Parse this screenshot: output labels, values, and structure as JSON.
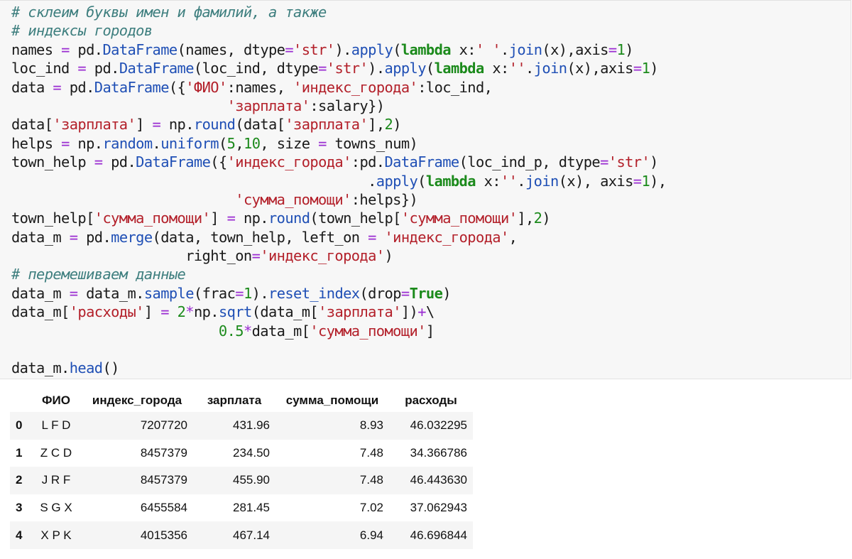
{
  "code": {
    "lines": [
      [
        [
          "cm",
          "# склеим буквы имен и фамилий, а также"
        ]
      ],
      [
        [
          "cm",
          "# индексы городов"
        ]
      ],
      [
        [
          "tx",
          "names "
        ],
        [
          "op",
          "="
        ],
        [
          "tx",
          " pd."
        ],
        [
          "at",
          "DataFrame"
        ],
        [
          "tx",
          "(names, dtype"
        ],
        [
          "op",
          "="
        ],
        [
          "st",
          "'str'"
        ],
        [
          "tx",
          ")."
        ],
        [
          "at",
          "apply"
        ],
        [
          "tx",
          "("
        ],
        [
          "kw",
          "lambda"
        ],
        [
          "tx",
          " x:"
        ],
        [
          "st",
          "' '"
        ],
        [
          "tx",
          "."
        ],
        [
          "at",
          "join"
        ],
        [
          "tx",
          "(x),axis"
        ],
        [
          "op",
          "="
        ],
        [
          "nm",
          "1"
        ],
        [
          "tx",
          ")"
        ]
      ],
      [
        [
          "tx",
          "loc_ind "
        ],
        [
          "op",
          "="
        ],
        [
          "tx",
          " pd."
        ],
        [
          "at",
          "DataFrame"
        ],
        [
          "tx",
          "(loc_ind, dtype"
        ],
        [
          "op",
          "="
        ],
        [
          "st",
          "'str'"
        ],
        [
          "tx",
          ")."
        ],
        [
          "at",
          "apply"
        ],
        [
          "tx",
          "("
        ],
        [
          "kw",
          "lambda"
        ],
        [
          "tx",
          " x:"
        ],
        [
          "st",
          "''"
        ],
        [
          "tx",
          "."
        ],
        [
          "at",
          "join"
        ],
        [
          "tx",
          "(x),axis"
        ],
        [
          "op",
          "="
        ],
        [
          "nm",
          "1"
        ],
        [
          "tx",
          ")"
        ]
      ],
      [
        [
          "tx",
          "data "
        ],
        [
          "op",
          "="
        ],
        [
          "tx",
          " pd."
        ],
        [
          "at",
          "DataFrame"
        ],
        [
          "tx",
          "({"
        ],
        [
          "st",
          "'ФИО'"
        ],
        [
          "tx",
          ":names, "
        ],
        [
          "st",
          "'индекс_города'"
        ],
        [
          "tx",
          ":loc_ind,"
        ]
      ],
      [
        [
          "tx",
          "                          "
        ],
        [
          "st",
          "'зарплата'"
        ],
        [
          "tx",
          ":salary})"
        ]
      ],
      [
        [
          "tx",
          "data["
        ],
        [
          "st",
          "'зарплата'"
        ],
        [
          "tx",
          "] "
        ],
        [
          "op",
          "="
        ],
        [
          "tx",
          " np."
        ],
        [
          "at",
          "round"
        ],
        [
          "tx",
          "(data["
        ],
        [
          "st",
          "'зарплата'"
        ],
        [
          "tx",
          "],"
        ],
        [
          "nm",
          "2"
        ],
        [
          "tx",
          ")"
        ]
      ],
      [
        [
          "tx",
          "helps "
        ],
        [
          "op",
          "="
        ],
        [
          "tx",
          " np."
        ],
        [
          "at",
          "random"
        ],
        [
          "tx",
          "."
        ],
        [
          "at",
          "uniform"
        ],
        [
          "tx",
          "("
        ],
        [
          "nm",
          "5"
        ],
        [
          "tx",
          ","
        ],
        [
          "nm",
          "10"
        ],
        [
          "tx",
          ", size "
        ],
        [
          "op",
          "="
        ],
        [
          "tx",
          " towns_num)"
        ]
      ],
      [
        [
          "tx",
          "town_help "
        ],
        [
          "op",
          "="
        ],
        [
          "tx",
          " pd."
        ],
        [
          "at",
          "DataFrame"
        ],
        [
          "tx",
          "({"
        ],
        [
          "st",
          "'индекс_города'"
        ],
        [
          "tx",
          ":pd."
        ],
        [
          "at",
          "DataFrame"
        ],
        [
          "tx",
          "(loc_ind_p, dtype"
        ],
        [
          "op",
          "="
        ],
        [
          "st",
          "'str'"
        ],
        [
          "tx",
          ")"
        ]
      ],
      [
        [
          "tx",
          "                                           ."
        ],
        [
          "at",
          "apply"
        ],
        [
          "tx",
          "("
        ],
        [
          "kw",
          "lambda"
        ],
        [
          "tx",
          " x:"
        ],
        [
          "st",
          "''"
        ],
        [
          "tx",
          "."
        ],
        [
          "at",
          "join"
        ],
        [
          "tx",
          "(x), axis"
        ],
        [
          "op",
          "="
        ],
        [
          "nm",
          "1"
        ],
        [
          "tx",
          "),"
        ]
      ],
      [
        [
          "tx",
          "                           "
        ],
        [
          "st",
          "'сумма_помощи'"
        ],
        [
          "tx",
          ":helps})"
        ]
      ],
      [
        [
          "tx",
          "town_help["
        ],
        [
          "st",
          "'сумма_помощи'"
        ],
        [
          "tx",
          "] "
        ],
        [
          "op",
          "="
        ],
        [
          "tx",
          " np."
        ],
        [
          "at",
          "round"
        ],
        [
          "tx",
          "(town_help["
        ],
        [
          "st",
          "'сумма_помощи'"
        ],
        [
          "tx",
          "],"
        ],
        [
          "nm",
          "2"
        ],
        [
          "tx",
          ")"
        ]
      ],
      [
        [
          "tx",
          "data_m "
        ],
        [
          "op",
          "="
        ],
        [
          "tx",
          " pd."
        ],
        [
          "at",
          "merge"
        ],
        [
          "tx",
          "(data, town_help, left_on "
        ],
        [
          "op",
          "="
        ],
        [
          "tx",
          " "
        ],
        [
          "st",
          "'индекс_города'"
        ],
        [
          "tx",
          ","
        ]
      ],
      [
        [
          "tx",
          "                     right_on"
        ],
        [
          "op",
          "="
        ],
        [
          "st",
          "'индекс_города'"
        ],
        [
          "tx",
          ")"
        ]
      ],
      [
        [
          "cm",
          "# перемешиваем данные"
        ]
      ],
      [
        [
          "tx",
          "data_m "
        ],
        [
          "op",
          "="
        ],
        [
          "tx",
          " data_m."
        ],
        [
          "at",
          "sample"
        ],
        [
          "tx",
          "(frac"
        ],
        [
          "op",
          "="
        ],
        [
          "nm",
          "1"
        ],
        [
          "tx",
          ")."
        ],
        [
          "at",
          "reset_index"
        ],
        [
          "tx",
          "(drop"
        ],
        [
          "op",
          "="
        ],
        [
          "kw",
          "True"
        ],
        [
          "tx",
          ")"
        ]
      ],
      [
        [
          "tx",
          "data_m["
        ],
        [
          "st",
          "'расходы'"
        ],
        [
          "tx",
          "] "
        ],
        [
          "op",
          "="
        ],
        [
          "tx",
          " "
        ],
        [
          "nm",
          "2"
        ],
        [
          "op",
          "*"
        ],
        [
          "tx",
          "np."
        ],
        [
          "at",
          "sqrt"
        ],
        [
          "tx",
          "(data_m["
        ],
        [
          "st",
          "'зарплата'"
        ],
        [
          "tx",
          "])"
        ],
        [
          "op",
          "+"
        ],
        [
          "tx",
          "\\"
        ]
      ],
      [
        [
          "tx",
          "                         "
        ],
        [
          "nm",
          "0.5"
        ],
        [
          "op",
          "*"
        ],
        [
          "tx",
          "data_m["
        ],
        [
          "st",
          "'сумма_помощи'"
        ],
        [
          "tx",
          "]"
        ]
      ],
      [],
      [
        [
          "tx",
          "data_m."
        ],
        [
          "at",
          "head"
        ],
        [
          "tx",
          "()"
        ]
      ]
    ]
  },
  "output_table": {
    "columns": [
      "",
      "ФИО",
      "индекс_города",
      "зарплата",
      "сумма_помощи",
      "расходы"
    ],
    "rows": [
      [
        "0",
        "L F D",
        "7207720",
        "431.96",
        "8.93",
        "46.032295"
      ],
      [
        "1",
        "Z C D",
        "8457379",
        "234.50",
        "7.48",
        "34.366786"
      ],
      [
        "2",
        "J R F",
        "8457379",
        "455.90",
        "7.48",
        "46.443630"
      ],
      [
        "3",
        "S G X",
        "6455584",
        "281.45",
        "7.02",
        "37.062943"
      ],
      [
        "4",
        "X P K",
        "4015356",
        "467.14",
        "6.94",
        "46.696844"
      ]
    ]
  }
}
